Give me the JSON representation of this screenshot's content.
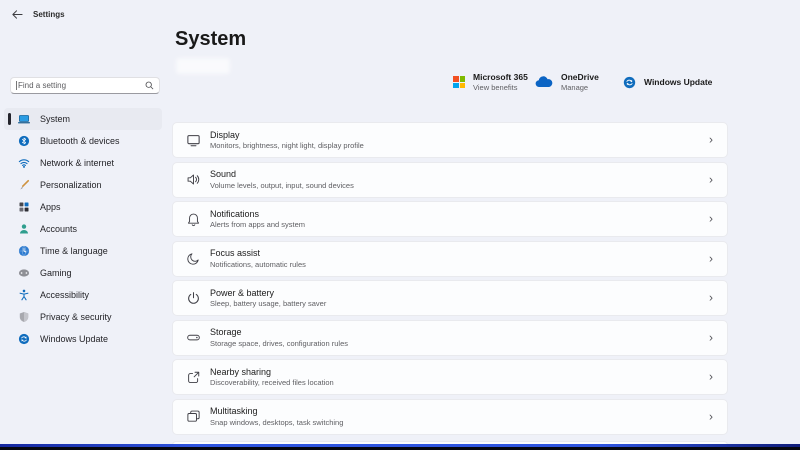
{
  "window": {
    "title": "Settings",
    "back_icon": "back-arrow-icon"
  },
  "search": {
    "placeholder": "Find a setting",
    "icon": "search-icon"
  },
  "sidebar": {
    "items": [
      {
        "label": "System",
        "icon": "system-icon",
        "selected": true
      },
      {
        "label": "Bluetooth & devices",
        "icon": "bluetooth-icon",
        "selected": false
      },
      {
        "label": "Network & internet",
        "icon": "network-icon",
        "selected": false
      },
      {
        "label": "Personalization",
        "icon": "personalization-icon",
        "selected": false
      },
      {
        "label": "Apps",
        "icon": "apps-icon",
        "selected": false
      },
      {
        "label": "Accounts",
        "icon": "accounts-icon",
        "selected": false
      },
      {
        "label": "Time & language",
        "icon": "time-language-icon",
        "selected": false
      },
      {
        "label": "Gaming",
        "icon": "gaming-icon",
        "selected": false
      },
      {
        "label": "Accessibility",
        "icon": "accessibility-icon",
        "selected": false
      },
      {
        "label": "Privacy & security",
        "icon": "privacy-security-icon",
        "selected": false
      },
      {
        "label": "Windows Update",
        "icon": "windows-update-icon",
        "selected": false
      }
    ]
  },
  "page": {
    "title": "System"
  },
  "quick_cards": [
    {
      "title": "Microsoft 365",
      "subtitle": "View benefits",
      "icon": "microsoft-logo"
    },
    {
      "title": "OneDrive",
      "subtitle": "Manage",
      "icon": "onedrive-icon"
    },
    {
      "title": "Windows Update",
      "subtitle": "",
      "icon": "windows-update-icon"
    }
  ],
  "settings_rows": [
    {
      "title": "Display",
      "subtitle": "Monitors, brightness, night light, display profile",
      "icon": "display-icon"
    },
    {
      "title": "Sound",
      "subtitle": "Volume levels, output, input, sound devices",
      "icon": "sound-icon"
    },
    {
      "title": "Notifications",
      "subtitle": "Alerts from apps and system",
      "icon": "notifications-icon"
    },
    {
      "title": "Focus assist",
      "subtitle": "Notifications, automatic rules",
      "icon": "focus-assist-icon"
    },
    {
      "title": "Power & battery",
      "subtitle": "Sleep, battery usage, battery saver",
      "icon": "power-icon"
    },
    {
      "title": "Storage",
      "subtitle": "Storage space, drives, configuration rules",
      "icon": "storage-icon"
    },
    {
      "title": "Nearby sharing",
      "subtitle": "Discoverability, received files location",
      "icon": "nearby-sharing-icon"
    },
    {
      "title": "Multitasking",
      "subtitle": "Snap windows, desktops, task switching",
      "icon": "multitasking-icon"
    }
  ],
  "icons": {
    "chevron": "›"
  },
  "colors": {
    "background": "#eff1f8",
    "card": "#fcfdfe",
    "accent_blue": "#0f6cbd",
    "ms_logo": [
      "#f25022",
      "#7fba00",
      "#00a4ef",
      "#ffb900"
    ],
    "onedrive_blue": "#0b64c4",
    "bottom_edge_blue": "#2f55e0",
    "bottom_edge_black": "#06070f"
  }
}
